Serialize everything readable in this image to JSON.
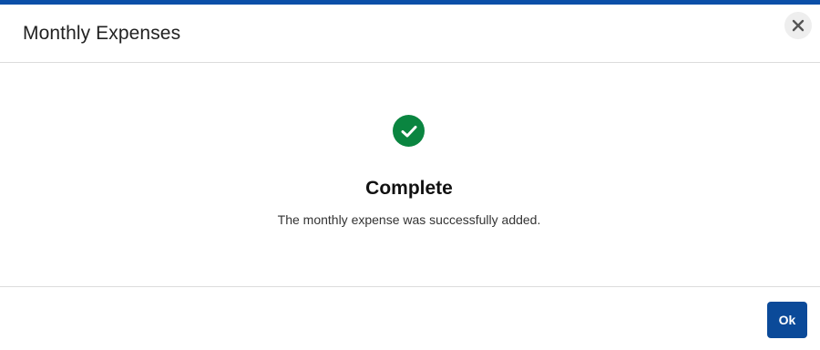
{
  "colors": {
    "accent": "#0b4fa8",
    "success": "#0a8540",
    "ok_button": "#0b4a99",
    "close_icon": "#555555"
  },
  "dialog": {
    "title": "Monthly Expenses",
    "close_icon": "close-icon"
  },
  "status": {
    "icon": "checkmark-circle-icon",
    "heading": "Complete",
    "message": "The monthly expense was successfully added."
  },
  "footer": {
    "ok_label": "Ok"
  }
}
